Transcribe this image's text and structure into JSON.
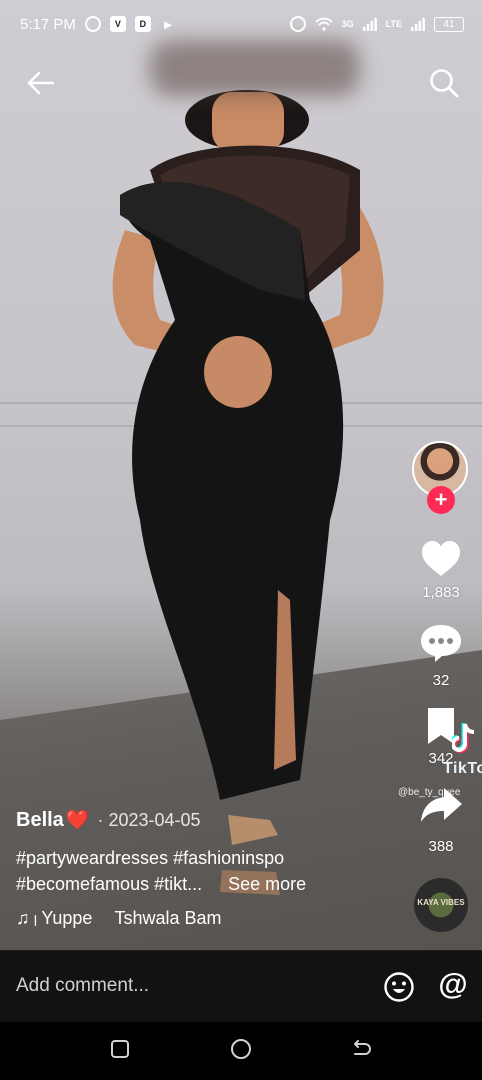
{
  "status_bar": {
    "time": "5:17 PM",
    "network_3g": "3G",
    "network_lte": "LTE",
    "battery": "41",
    "icons": [
      "whatsapp-icon",
      "vidmate-icon",
      "office-icon",
      "app-icon",
      "alarm-icon",
      "wifi-icon",
      "signal-icon",
      "signal-icon"
    ]
  },
  "nav": {
    "back_icon": "arrow-left-icon",
    "search_icon": "search-icon"
  },
  "right_rail": {
    "avatar": "creator-avatar",
    "follow_label": "+",
    "likes": "1,883",
    "comments": "32",
    "saves": "342",
    "shares": "388",
    "follow_color": "#fe2c55"
  },
  "watermark": {
    "logo": "TikTok",
    "user": "@be_ty_quee"
  },
  "caption": {
    "author": "Bella",
    "author_emoji": "❤️",
    "date": "· 2023-04-05",
    "line1": "#partyweardresses #fashioninspo",
    "line2": "#becomefamous #tikt...",
    "see_more": "See more"
  },
  "music": {
    "note_icon": "music-note-icon",
    "song": "Yuppe",
    "artist": "Tshwala Bam",
    "disc_label": "KAYA VIBES"
  },
  "comment_bar": {
    "placeholder": "Add comment...",
    "emoji_icon": "emoji-icon",
    "mention_label": "@"
  },
  "android_nav": {
    "recent": "recent-apps-icon",
    "home": "home-icon",
    "back": "back-icon"
  }
}
